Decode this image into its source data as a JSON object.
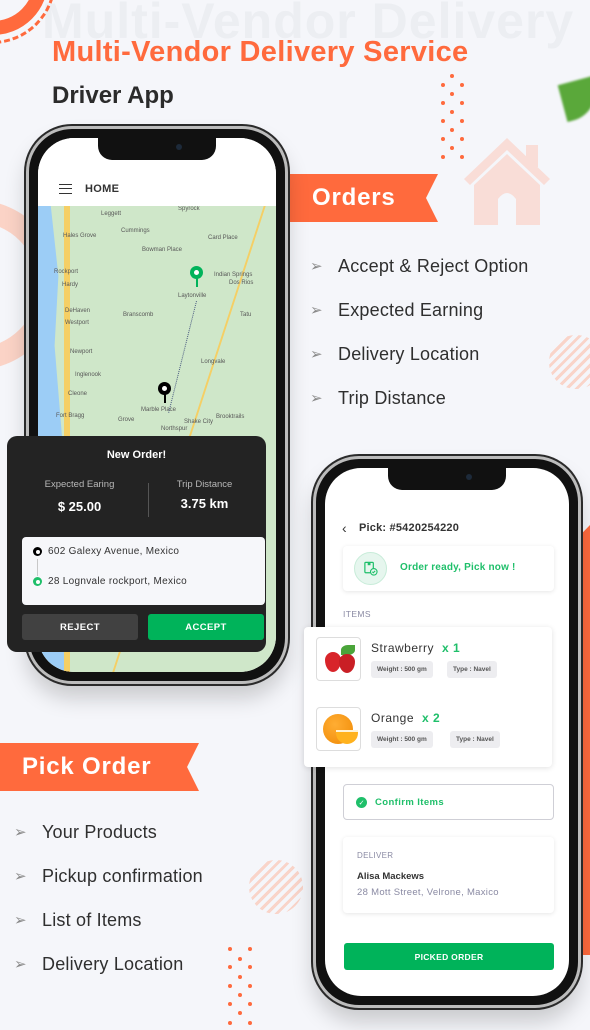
{
  "header": {
    "watermark": "Multi-Vendor Delivery Service",
    "title": "Multi-Vendor Delivery Service",
    "subtitle": "Driver App"
  },
  "colors": {
    "accent": "#ff6a3d",
    "success": "#00b35a",
    "dark_card": "#232323",
    "background": "#f5f6fa"
  },
  "orders_section": {
    "ribbon": "Orders",
    "features": [
      "Accept & Reject Option",
      "Expected Earning",
      "Delivery Location",
      "Trip Distance"
    ]
  },
  "pick_section": {
    "ribbon": "Pick Order",
    "features": [
      "Your Products",
      "Pickup confirmation",
      "List of Items",
      "Delivery Location"
    ]
  },
  "list_arrow_icon": "➢",
  "phone1": {
    "header_icon": "hamburger-menu-icon",
    "header_title": "HOME",
    "map_labels": [
      "Spyrock",
      "Leggett",
      "Cummings",
      "Hales Grove",
      "Card Place",
      "Bowman Place",
      "Rockport",
      "Hardy",
      "Indian Springs",
      "Dos Rios",
      "Laytonville",
      "DeHaven",
      "Westport",
      "Branscomb",
      "Tatu",
      "Newport",
      "Longvale",
      "Inglenook",
      "Cleone",
      "Marble Place",
      "Fort Bragg",
      "Grove",
      "Shake City",
      "Brooktrails",
      "Northspur"
    ],
    "route_markers": [
      "pickup-pin",
      "destination-pin"
    ],
    "order_card": {
      "title": "New Order!",
      "earning_label": "Expected Earing",
      "earning_value": "$ 25.00",
      "distance_label": "Trip Distance",
      "distance_value": "3.75 km",
      "from_address": "602 Galexy Avenue, Mexico",
      "to_address": "28 Lognvale rockport, Mexico",
      "reject_label": "REJECT",
      "accept_label": "ACCEPT"
    }
  },
  "phone2": {
    "back_icon": "‹",
    "pick_title": "Pick: #5420254220",
    "ready_text": "Order ready, Pick now !",
    "ready_icon": "package-check-icon",
    "items_label": "ITEMS",
    "items": [
      {
        "name": "Strawberry",
        "qty": "x 1",
        "weight": "Weight : 500 gm",
        "type": "Type : Navel",
        "image": "strawberry"
      },
      {
        "name": "Orange",
        "qty": "x 2",
        "weight": "Weight : 500 gm",
        "type": "Type : Navel",
        "image": "orange"
      }
    ],
    "confirm_label": "Confirm Items",
    "deliver_label": "DELIVER",
    "deliver_name": "Alisa Mackews",
    "deliver_address": "28 Mott Street, Velrone, Maxico",
    "picked_button": "PICKED ORDER"
  }
}
